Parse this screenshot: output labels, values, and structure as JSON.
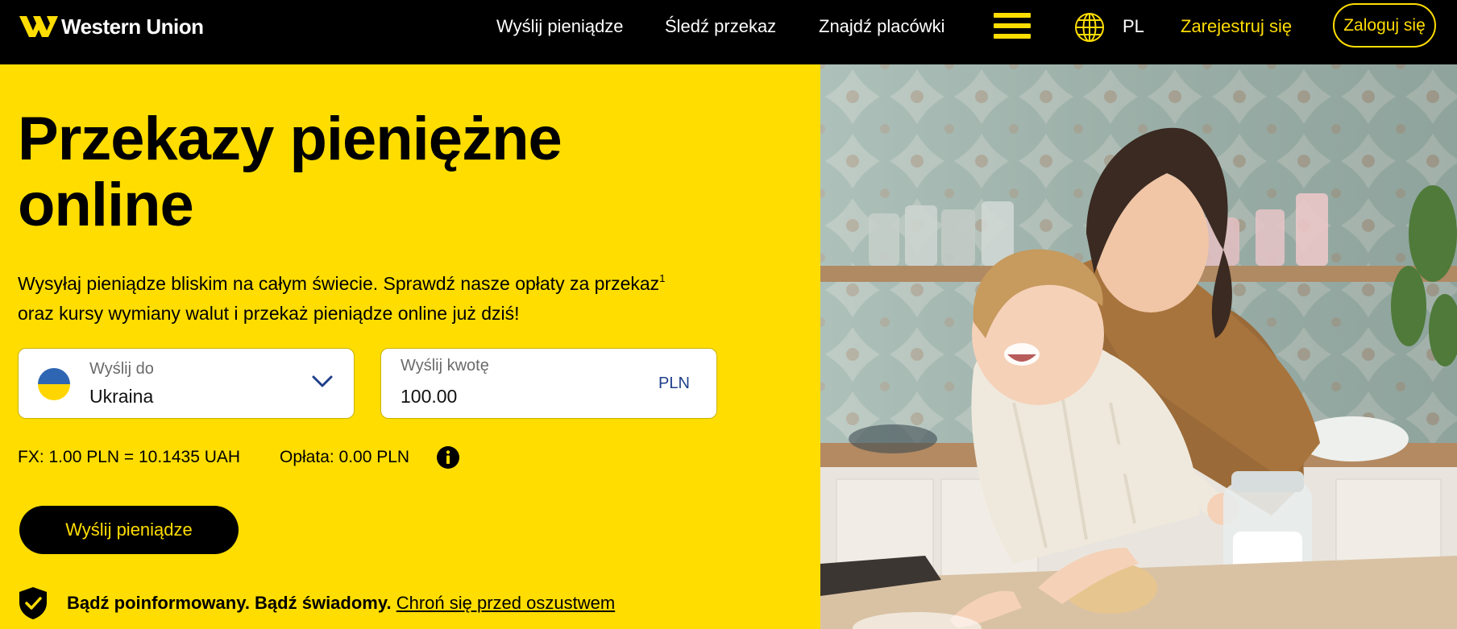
{
  "brand": {
    "name": "Western Union"
  },
  "nav": {
    "send_money": "Wyślij pieniądze",
    "track_transfer": "Śledź przekaz",
    "find_locations": "Znajdź placówki",
    "language": "PL",
    "register": "Zarejestruj się",
    "login": "Zaloguj się"
  },
  "hero": {
    "headline": "Przekazy pieniężne online",
    "subtitle_line1": "Wysyłaj pieniądze bliskim na całym świecie. Sprawdź nasze opłaty za przekaz",
    "subtitle_sup": "1",
    "subtitle_line2": "oraz kursy wymiany walut i przekaż pieniądze online już dziś!"
  },
  "form": {
    "destination_label": "Wyślij do",
    "destination_value": "Ukraina",
    "amount_label": "Wyślij kwotę",
    "amount_value": "100.00",
    "amount_currency": "PLN",
    "fx_rate": "FX: 1.00 PLN = 10.1435 UAH",
    "fee": "Opłata: 0.00 PLN",
    "send_button": "Wyślij pieniądze"
  },
  "fraud_notice": {
    "bold_text": "Bądź poinformowany. Bądź świadomy.",
    "link_text": "Chroń się przed oszustwem"
  },
  "colors": {
    "brand_yellow": "#ffdd00",
    "header_bg": "#000000",
    "currency_blue": "#1f3f8a",
    "flag_blue": "#2f66b3",
    "flag_yellow": "#ffd500"
  },
  "icons": {
    "logo": "western-union-logo-icon",
    "menu": "hamburger-menu-icon",
    "language": "globe-icon",
    "dropdown": "chevron-down-icon",
    "info": "info-icon",
    "fraud": "shield-check-icon"
  }
}
